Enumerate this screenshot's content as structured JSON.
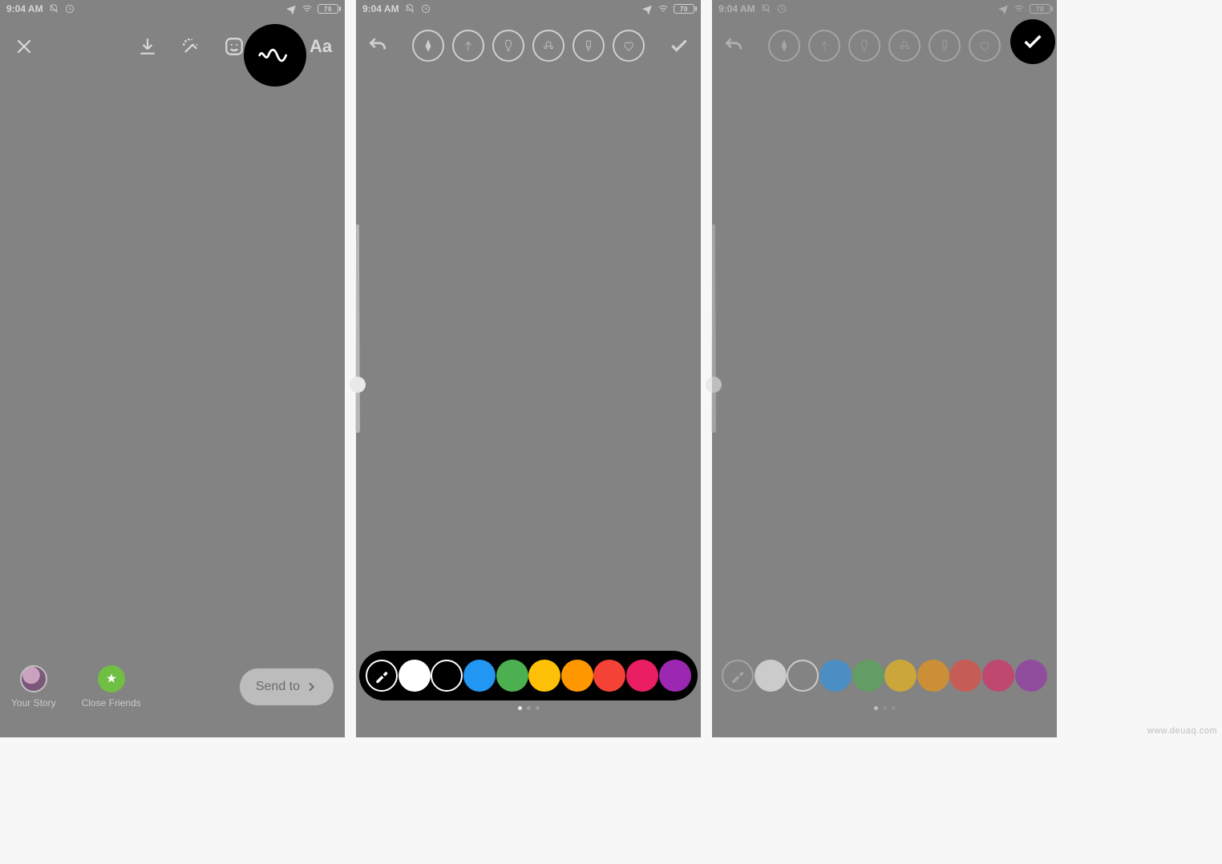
{
  "status": {
    "time": "9:04 AM",
    "battery": "70"
  },
  "panel1": {
    "title": "instagram-story-editor",
    "topbar": {
      "close": "close",
      "download": "download",
      "effects": "effects",
      "sticker": "sticker",
      "draw": "draw",
      "text": "Aa"
    },
    "share": {
      "your_story": "Your Story",
      "close_friends": "Close Friends",
      "send_to": "Send to"
    }
  },
  "panel2": {
    "tools": [
      "pen",
      "arrow",
      "marker",
      "neon",
      "chisel",
      "heart"
    ],
    "colors": [
      {
        "name": "white",
        "hex": "#ffffff"
      },
      {
        "name": "black",
        "hex": "#000000",
        "outlined": true
      },
      {
        "name": "blue",
        "hex": "#2196f3"
      },
      {
        "name": "green",
        "hex": "#4caf50"
      },
      {
        "name": "yellow",
        "hex": "#ffc107"
      },
      {
        "name": "orange",
        "hex": "#ff9800"
      },
      {
        "name": "red",
        "hex": "#f44336"
      },
      {
        "name": "magenta",
        "hex": "#e91e63"
      },
      {
        "name": "purple",
        "hex": "#9c27b0"
      }
    ],
    "page": 0,
    "pages": 3
  },
  "panel3": {
    "tools": [
      "pen",
      "arrow",
      "marker",
      "neon",
      "chisel",
      "heart"
    ],
    "colors": [
      {
        "name": "white",
        "hex": "#ffffff"
      },
      {
        "name": "black",
        "hex": "#000000",
        "outlined": true
      },
      {
        "name": "blue",
        "hex": "#2196f3"
      },
      {
        "name": "green",
        "hex": "#4caf50"
      },
      {
        "name": "yellow",
        "hex": "#ffc107"
      },
      {
        "name": "orange",
        "hex": "#ff9800"
      },
      {
        "name": "red",
        "hex": "#f44336"
      },
      {
        "name": "magenta",
        "hex": "#e91e63"
      },
      {
        "name": "purple",
        "hex": "#9c27b0"
      }
    ],
    "page": 0,
    "pages": 3
  },
  "watermark": "www.deuaq.com"
}
